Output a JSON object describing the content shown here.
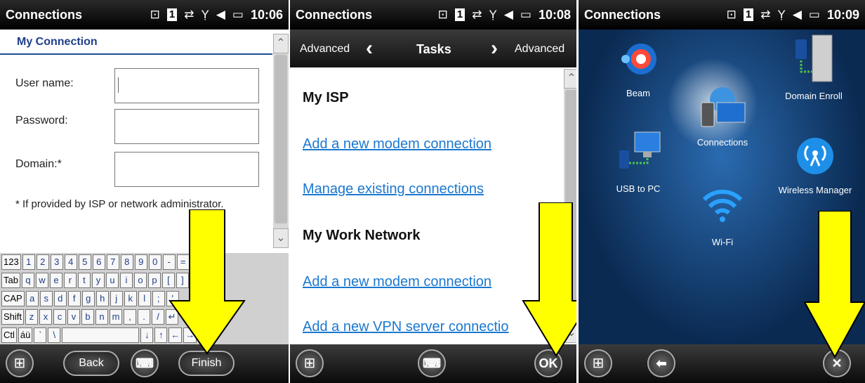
{
  "panels": [
    {
      "status": {
        "title": "Connections",
        "time": "10:06"
      },
      "header": "My Connection",
      "fields": [
        {
          "label": "User name:",
          "value": ""
        },
        {
          "label": "Password:",
          "value": ""
        },
        {
          "label": "Domain:*",
          "value": ""
        }
      ],
      "note": "* If provided by ISP or network administrator.",
      "keyboard": {
        "rows": [
          [
            "123",
            "1",
            "2",
            "3",
            "4",
            "5",
            "6",
            "7",
            "8",
            "9",
            "0",
            "-",
            "=",
            "←"
          ],
          [
            "Tab",
            "q",
            "w",
            "e",
            "r",
            "t",
            "y",
            "u",
            "i",
            "o",
            "p",
            "[",
            "]"
          ],
          [
            "CAP",
            "a",
            "s",
            "d",
            "f",
            "g",
            "h",
            "j",
            "k",
            "l",
            ";",
            "'"
          ],
          [
            "Shift",
            "z",
            "x",
            "c",
            "v",
            "b",
            "n",
            "m",
            ",",
            ".",
            "/",
            "↵"
          ],
          [
            "Ctl",
            "áü",
            "`",
            "\\",
            "",
            "↓",
            "↑",
            "←",
            "→"
          ]
        ]
      },
      "bottom": {
        "back": "Back",
        "finish": "Finish"
      }
    },
    {
      "status": {
        "title": "Connections",
        "time": "10:08"
      },
      "tasksbar": {
        "left": "Advanced",
        "title": "Tasks",
        "right": "Advanced"
      },
      "sections": [
        {
          "heading": "My ISP",
          "links": [
            "Add a new modem connection",
            "Manage existing connections"
          ]
        },
        {
          "heading": "My Work Network",
          "links": [
            "Add a new modem connection",
            "Add a new VPN server connectio"
          ]
        }
      ],
      "bottom": {
        "ok": "OK"
      }
    },
    {
      "status": {
        "title": "Connections",
        "time": "10:09"
      },
      "apps": [
        {
          "label": "Beam",
          "icon": "beam-icon"
        },
        {
          "label": "Domain Enroll",
          "icon": "domain-enroll-icon"
        },
        {
          "label": "Connections",
          "icon": "connections-icon"
        },
        {
          "label": "USB to PC",
          "icon": "usb-to-pc-icon"
        },
        {
          "label": "Wireless Manager",
          "icon": "wireless-manager-icon"
        },
        {
          "label": "Wi-Fi",
          "icon": "wifi-icon"
        }
      ]
    }
  ],
  "colors": {
    "arrow": "#ffff00",
    "link": "#1a78d0",
    "header": "#1f3f88"
  }
}
